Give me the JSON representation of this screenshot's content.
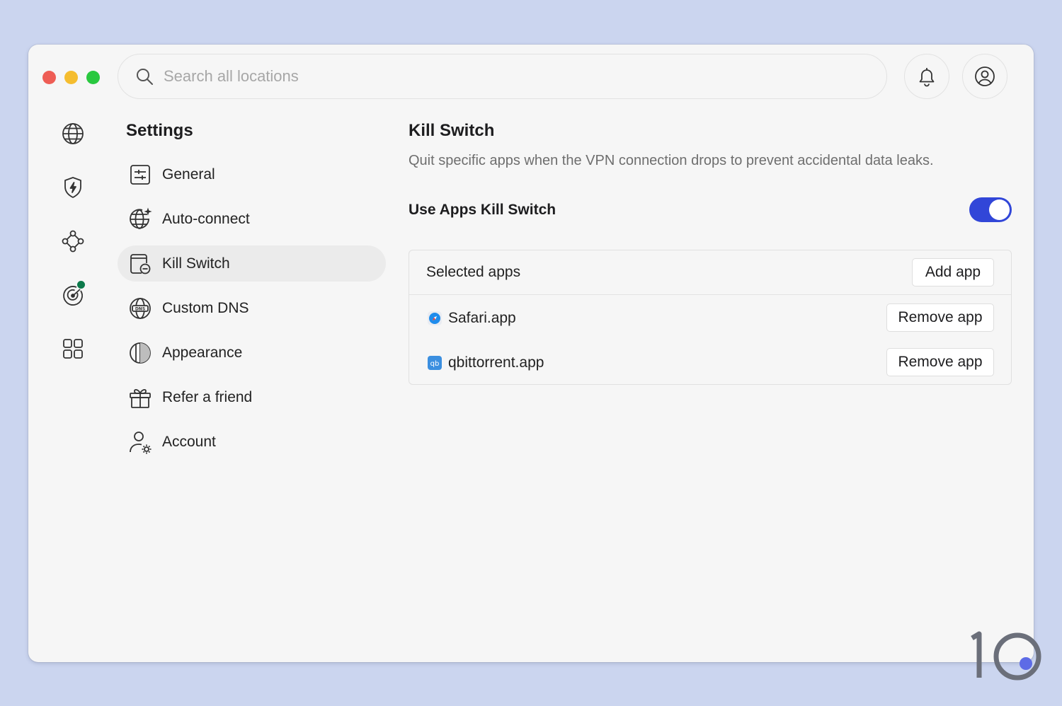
{
  "window": {
    "traffic_lights": [
      "close",
      "minimize",
      "zoom"
    ]
  },
  "search": {
    "placeholder": "Search all locations",
    "icon": "search-icon"
  },
  "header": {
    "bell_icon": "bell-icon",
    "user_icon": "user-circle-icon"
  },
  "rail": {
    "items": [
      {
        "icon": "globe-icon"
      },
      {
        "icon": "shield-bolt-icon"
      },
      {
        "icon": "nodes-icon"
      },
      {
        "icon": "radar-icon",
        "status_dot_color": "#0c7a4b"
      },
      {
        "icon": "grid-icon"
      }
    ]
  },
  "settings": {
    "title": "Settings",
    "menu": [
      {
        "label": "General",
        "icon": "sliders-icon"
      },
      {
        "label": "Auto-connect",
        "icon": "globe-sparkle-icon"
      },
      {
        "label": "Kill Switch",
        "icon": "kill-switch-icon",
        "active": true
      },
      {
        "label": "Custom DNS",
        "icon": "dns-globe-icon"
      },
      {
        "label": "Appearance",
        "icon": "appearance-icon"
      },
      {
        "label": "Refer a friend",
        "icon": "gift-icon"
      },
      {
        "label": "Account",
        "icon": "account-gear-icon"
      }
    ]
  },
  "pane": {
    "title": "Kill Switch",
    "description": "Quit specific apps when the VPN connection drops to prevent accidental data leaks.",
    "toggle_label": "Use Apps Kill Switch",
    "toggle_on": true,
    "accent_color": "#3146d8",
    "apps": {
      "header_label": "Selected apps",
      "add_button": "Add app",
      "items": [
        {
          "name": "Safari.app",
          "icon": "safari-icon",
          "remove_label": "Remove app"
        },
        {
          "name": "qbittorrent.app",
          "icon": "qbittorrent-icon",
          "icon_text": "qb",
          "remove_label": "Remove app"
        }
      ]
    }
  },
  "watermark": {
    "text": "10"
  }
}
